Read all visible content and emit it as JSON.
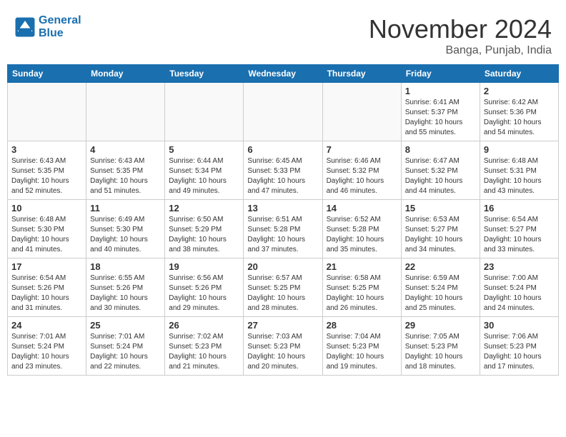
{
  "header": {
    "logo_line1": "General",
    "logo_line2": "Blue",
    "month": "November 2024",
    "location": "Banga, Punjab, India"
  },
  "days_of_week": [
    "Sunday",
    "Monday",
    "Tuesday",
    "Wednesday",
    "Thursday",
    "Friday",
    "Saturday"
  ],
  "weeks": [
    [
      {
        "day": "",
        "info": ""
      },
      {
        "day": "",
        "info": ""
      },
      {
        "day": "",
        "info": ""
      },
      {
        "day": "",
        "info": ""
      },
      {
        "day": "",
        "info": ""
      },
      {
        "day": "1",
        "info": "Sunrise: 6:41 AM\nSunset: 5:37 PM\nDaylight: 10 hours\nand 55 minutes."
      },
      {
        "day": "2",
        "info": "Sunrise: 6:42 AM\nSunset: 5:36 PM\nDaylight: 10 hours\nand 54 minutes."
      }
    ],
    [
      {
        "day": "3",
        "info": "Sunrise: 6:43 AM\nSunset: 5:35 PM\nDaylight: 10 hours\nand 52 minutes."
      },
      {
        "day": "4",
        "info": "Sunrise: 6:43 AM\nSunset: 5:35 PM\nDaylight: 10 hours\nand 51 minutes."
      },
      {
        "day": "5",
        "info": "Sunrise: 6:44 AM\nSunset: 5:34 PM\nDaylight: 10 hours\nand 49 minutes."
      },
      {
        "day": "6",
        "info": "Sunrise: 6:45 AM\nSunset: 5:33 PM\nDaylight: 10 hours\nand 47 minutes."
      },
      {
        "day": "7",
        "info": "Sunrise: 6:46 AM\nSunset: 5:32 PM\nDaylight: 10 hours\nand 46 minutes."
      },
      {
        "day": "8",
        "info": "Sunrise: 6:47 AM\nSunset: 5:32 PM\nDaylight: 10 hours\nand 44 minutes."
      },
      {
        "day": "9",
        "info": "Sunrise: 6:48 AM\nSunset: 5:31 PM\nDaylight: 10 hours\nand 43 minutes."
      }
    ],
    [
      {
        "day": "10",
        "info": "Sunrise: 6:48 AM\nSunset: 5:30 PM\nDaylight: 10 hours\nand 41 minutes."
      },
      {
        "day": "11",
        "info": "Sunrise: 6:49 AM\nSunset: 5:30 PM\nDaylight: 10 hours\nand 40 minutes."
      },
      {
        "day": "12",
        "info": "Sunrise: 6:50 AM\nSunset: 5:29 PM\nDaylight: 10 hours\nand 38 minutes."
      },
      {
        "day": "13",
        "info": "Sunrise: 6:51 AM\nSunset: 5:28 PM\nDaylight: 10 hours\nand 37 minutes."
      },
      {
        "day": "14",
        "info": "Sunrise: 6:52 AM\nSunset: 5:28 PM\nDaylight: 10 hours\nand 35 minutes."
      },
      {
        "day": "15",
        "info": "Sunrise: 6:53 AM\nSunset: 5:27 PM\nDaylight: 10 hours\nand 34 minutes."
      },
      {
        "day": "16",
        "info": "Sunrise: 6:54 AM\nSunset: 5:27 PM\nDaylight: 10 hours\nand 33 minutes."
      }
    ],
    [
      {
        "day": "17",
        "info": "Sunrise: 6:54 AM\nSunset: 5:26 PM\nDaylight: 10 hours\nand 31 minutes."
      },
      {
        "day": "18",
        "info": "Sunrise: 6:55 AM\nSunset: 5:26 PM\nDaylight: 10 hours\nand 30 minutes."
      },
      {
        "day": "19",
        "info": "Sunrise: 6:56 AM\nSunset: 5:26 PM\nDaylight: 10 hours\nand 29 minutes."
      },
      {
        "day": "20",
        "info": "Sunrise: 6:57 AM\nSunset: 5:25 PM\nDaylight: 10 hours\nand 28 minutes."
      },
      {
        "day": "21",
        "info": "Sunrise: 6:58 AM\nSunset: 5:25 PM\nDaylight: 10 hours\nand 26 minutes."
      },
      {
        "day": "22",
        "info": "Sunrise: 6:59 AM\nSunset: 5:24 PM\nDaylight: 10 hours\nand 25 minutes."
      },
      {
        "day": "23",
        "info": "Sunrise: 7:00 AM\nSunset: 5:24 PM\nDaylight: 10 hours\nand 24 minutes."
      }
    ],
    [
      {
        "day": "24",
        "info": "Sunrise: 7:01 AM\nSunset: 5:24 PM\nDaylight: 10 hours\nand 23 minutes."
      },
      {
        "day": "25",
        "info": "Sunrise: 7:01 AM\nSunset: 5:24 PM\nDaylight: 10 hours\nand 22 minutes."
      },
      {
        "day": "26",
        "info": "Sunrise: 7:02 AM\nSunset: 5:23 PM\nDaylight: 10 hours\nand 21 minutes."
      },
      {
        "day": "27",
        "info": "Sunrise: 7:03 AM\nSunset: 5:23 PM\nDaylight: 10 hours\nand 20 minutes."
      },
      {
        "day": "28",
        "info": "Sunrise: 7:04 AM\nSunset: 5:23 PM\nDaylight: 10 hours\nand 19 minutes."
      },
      {
        "day": "29",
        "info": "Sunrise: 7:05 AM\nSunset: 5:23 PM\nDaylight: 10 hours\nand 18 minutes."
      },
      {
        "day": "30",
        "info": "Sunrise: 7:06 AM\nSunset: 5:23 PM\nDaylight: 10 hours\nand 17 minutes."
      }
    ]
  ]
}
